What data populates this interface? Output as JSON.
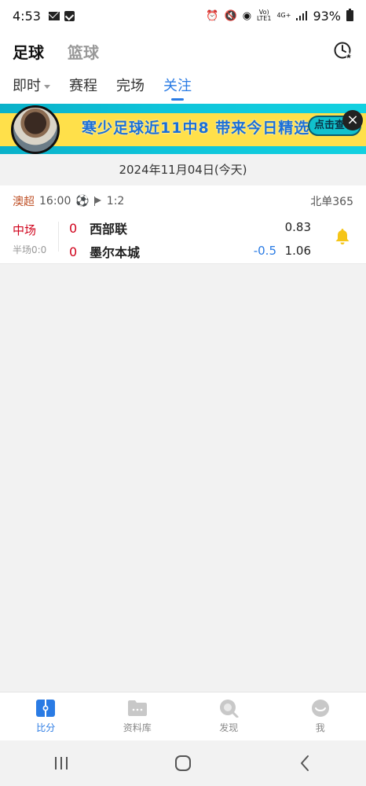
{
  "status_bar": {
    "time": "4:53",
    "network_label": "Vo)\nLTE1",
    "signal_label": "4G+",
    "battery": "93%"
  },
  "header": {
    "tabs": [
      {
        "label": "足球",
        "active": true
      },
      {
        "label": "篮球",
        "active": false
      }
    ],
    "history_icon": "clock-star-icon"
  },
  "subtabs": [
    {
      "label": "即时",
      "active": false,
      "has_dropdown": true
    },
    {
      "label": "赛程",
      "active": false
    },
    {
      "label": "完场",
      "active": false
    },
    {
      "label": "关注",
      "active": true
    }
  ],
  "banner": {
    "text": "寒少足球近11中8 带来今日精选",
    "cta": "点击查看",
    "close": "×"
  },
  "date_bar": {
    "text": "2024年11月04日(今天)"
  },
  "match": {
    "league": "澳超",
    "time": "16:00",
    "corner_ratio": "1:2",
    "bookmaker": "北单365",
    "status": "中场",
    "half_time_score": "半场0:0",
    "home": {
      "score": "0",
      "name": "西部联",
      "odds": "0.83"
    },
    "away": {
      "score": "0",
      "name": "墨尔本城",
      "odds": "1.06"
    },
    "handicap": "-0.5",
    "followed": true
  },
  "bottom_nav": [
    {
      "label": "比分",
      "icon": "scoreboard-icon",
      "active": true
    },
    {
      "label": "资料库",
      "icon": "folder-icon",
      "active": false
    },
    {
      "label": "发现",
      "icon": "discover-icon",
      "active": false
    },
    {
      "label": "我",
      "icon": "profile-icon",
      "active": false
    }
  ],
  "colors": {
    "accent": "#2a7be4",
    "live_red": "#d0021b",
    "banner_yellow": "#ffe04a",
    "banner_cyan": "#0ec4da",
    "bell": "#f5c518"
  }
}
